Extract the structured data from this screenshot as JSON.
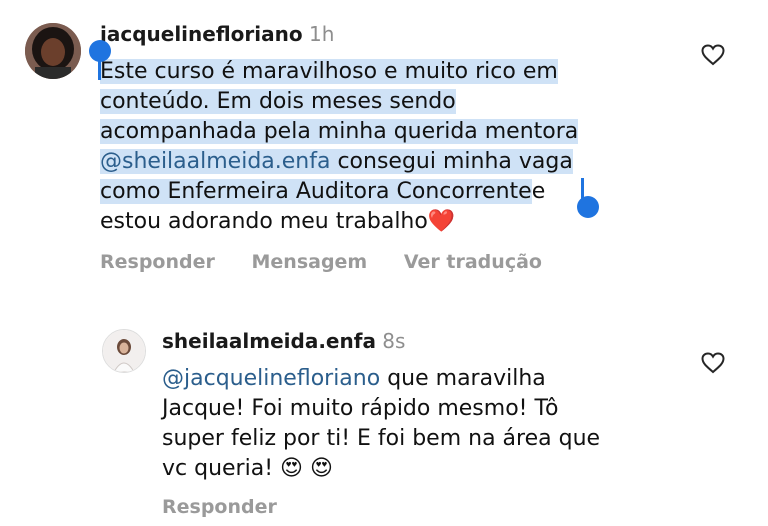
{
  "comments": [
    {
      "username": "jacquelinefloriano",
      "time": "1h",
      "lines": [
        "Este curso é maravilhoso e muito rico em",
        "conteúdo. Em dois meses sendo",
        "acompanhada pela minha querida mentora"
      ],
      "line4_mention": "@sheilaalmeida.enfa",
      "line4_rest": " consegui minha vaga",
      "line5_selected": "como Enfermeira Auditora Concorrente",
      "line5_rest": "e",
      "line6": "estou adorando meu trabalho",
      "line6_emoji": "❤️",
      "actions": {
        "reply": "Responder",
        "message": "Mensagem",
        "translate": "Ver tradução"
      }
    },
    {
      "username": "sheilaalmeida.enfa",
      "time": "8s",
      "line1_mention": "@jacquelinefloriano",
      "line1_rest": " que maravilha",
      "line2": "Jacque! Foi muito rápido mesmo! Tô",
      "line3": "super feliz por ti! E foi bem na área que",
      "line4": "vc queria!",
      "line4_emojis": "😍 😍",
      "actions": {
        "reply": "Responder"
      }
    }
  ],
  "colors": {
    "selection": "#cfe2f6",
    "mention": "#2b5e8c",
    "handle": "#1f74e0",
    "heart_emoji": "#e0245e"
  },
  "icons": [
    "heart-outline-icon",
    "selection-handle-start",
    "selection-handle-end"
  ]
}
